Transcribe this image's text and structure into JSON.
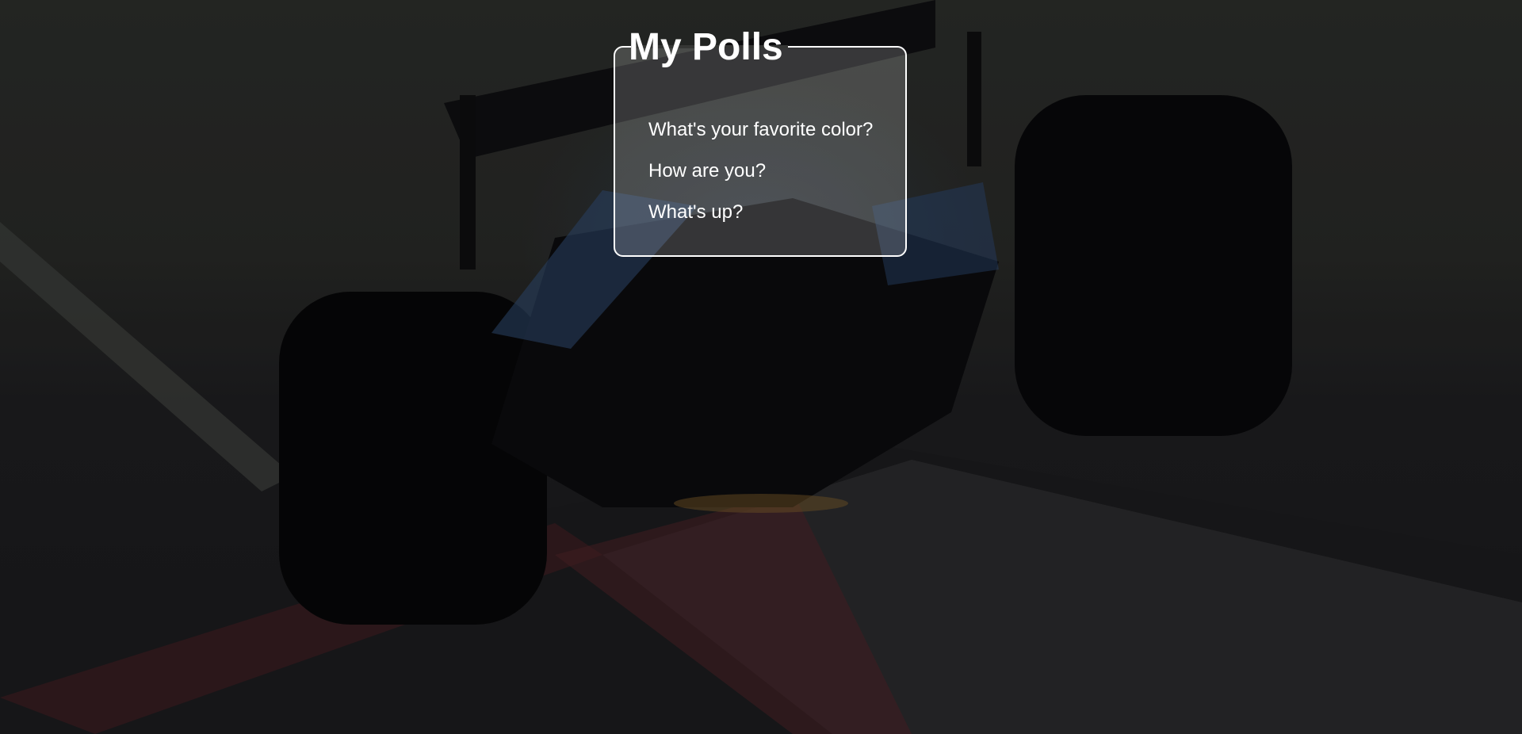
{
  "page": {
    "title": "My Polls"
  },
  "polls": [
    {
      "question": "What's your favorite color?"
    },
    {
      "question": "How are you?"
    },
    {
      "question": "What's up?"
    }
  ],
  "colors": {
    "panel_border": "#ffffff",
    "text": "#ffffff",
    "background": "#222222"
  },
  "background_image": "race-car-rear-view"
}
